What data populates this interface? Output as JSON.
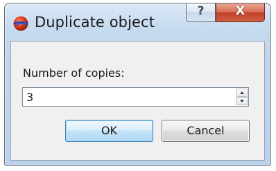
{
  "window": {
    "title": "Duplicate object",
    "icon": "red-blue-sphere-icon",
    "help_glyph": "?",
    "close_glyph": "X"
  },
  "form": {
    "copies_label": "Number of copies:",
    "copies_value": "3"
  },
  "buttons": {
    "ok_label": "OK",
    "cancel_label": "Cancel"
  },
  "colors": {
    "title_bar": "#c8dcf0",
    "close_button": "#c2422b",
    "ok_button_border": "#3c7fb1"
  }
}
